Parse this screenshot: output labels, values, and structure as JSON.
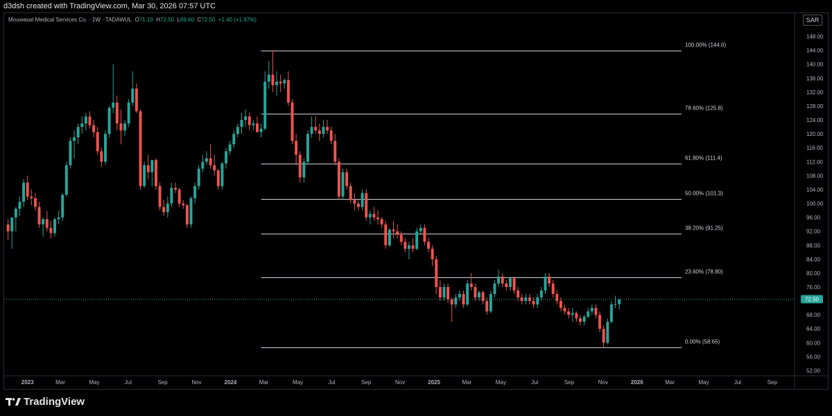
{
  "header": {
    "attribution": "d3dsh created with TradingView.com, Mar 30, 2026 07:57 UTC"
  },
  "legend": {
    "symbol": "Mouwasat Medical Services Co. · 1W · TADAWUL",
    "open_label": "O",
    "open": "71.10",
    "high_label": "H",
    "high": "72.50",
    "low_label": "L",
    "low": "69.60",
    "close_label": "C",
    "close": "72.50",
    "change": "+1.40 (+1.97%)"
  },
  "currency": "SAR",
  "brand": {
    "name": "TradingView",
    "logo_icon": "tradingview-logo-icon"
  },
  "colors": {
    "up": "#26a69a",
    "down": "#ef5350",
    "fib": "#d1d4dc",
    "price_tag": "#26a69a",
    "background": "#000000"
  },
  "chart_data": {
    "type": "candlestick",
    "timeframe": "1W",
    "y_axis": {
      "ticks": [
        "52.00",
        "56.00",
        "60.00",
        "64.00",
        "68.00",
        "72.00",
        "76.00",
        "80.00",
        "84.00",
        "88.00",
        "92.00",
        "96.00",
        "100.00",
        "104.00",
        "108.00",
        "112.00",
        "116.00",
        "120.00",
        "124.00",
        "128.00",
        "132.00",
        "136.00",
        "140.00",
        "144.00",
        "148.00"
      ],
      "range": [
        50.5,
        150.5
      ],
      "last_price_label": "72.50",
      "last_price": 72.5
    },
    "x_axis": {
      "range": [
        "2022-11-20",
        "2026-10-10"
      ],
      "ticks": [
        {
          "label": "2023",
          "date": "2023-01-01",
          "bold": true
        },
        {
          "label": "Mar",
          "date": "2023-03-01"
        },
        {
          "label": "May",
          "date": "2023-05-01"
        },
        {
          "label": "Jul",
          "date": "2023-07-01"
        },
        {
          "label": "Sep",
          "date": "2023-09-01"
        },
        {
          "label": "Nov",
          "date": "2023-11-01"
        },
        {
          "label": "2024",
          "date": "2024-01-01",
          "bold": true
        },
        {
          "label": "Mar",
          "date": "2024-03-01"
        },
        {
          "label": "May",
          "date": "2024-05-01"
        },
        {
          "label": "Jul",
          "date": "2024-07-01"
        },
        {
          "label": "Sep",
          "date": "2024-09-01"
        },
        {
          "label": "Nov",
          "date": "2024-11-01"
        },
        {
          "label": "2025",
          "date": "2025-01-01",
          "bold": true
        },
        {
          "label": "Mar",
          "date": "2025-03-01"
        },
        {
          "label": "May",
          "date": "2025-05-01"
        },
        {
          "label": "Jul",
          "date": "2025-07-01"
        },
        {
          "label": "Sep",
          "date": "2025-09-01"
        },
        {
          "label": "Nov",
          "date": "2025-11-01"
        },
        {
          "label": "2026",
          "date": "2026-01-01",
          "bold": true
        },
        {
          "label": "Mar",
          "date": "2026-03-01"
        },
        {
          "label": "May",
          "date": "2026-05-01"
        },
        {
          "label": "Jul",
          "date": "2026-07-01"
        },
        {
          "label": "Sep",
          "date": "2026-09-01"
        }
      ]
    },
    "fibonacci": {
      "start_date": "2024-02-25",
      "end_date": "2026-03-22",
      "levels": [
        {
          "label": "100.00% (144.0)",
          "value": 144.0
        },
        {
          "label": "78.60% (125.8)",
          "value": 125.8
        },
        {
          "label": "61.80% (111.4)",
          "value": 111.4
        },
        {
          "label": "50.00% (101.3)",
          "value": 101.3
        },
        {
          "label": "38.20% (91.25)",
          "value": 91.25
        },
        {
          "label": "23.60% (78.80)",
          "value": 78.8
        },
        {
          "label": "0.00% (58.65)",
          "value": 58.65
        }
      ]
    },
    "start_date": "2022-11-27",
    "candles": [
      [
        94.0,
        95.5,
        89.5,
        92.0
      ],
      [
        92.0,
        95.5,
        87.0,
        96.0
      ],
      [
        96.0,
        99.0,
        92.0,
        98.5
      ],
      [
        98.5,
        102.0,
        96.5,
        100.5
      ],
      [
        100.5,
        107.0,
        99.0,
        106.0
      ],
      [
        106.0,
        108.0,
        101.0,
        102.0
      ],
      [
        102.0,
        104.0,
        99.5,
        101.5
      ],
      [
        101.5,
        103.0,
        98.0,
        99.0
      ],
      [
        99.0,
        100.5,
        93.0,
        94.0
      ],
      [
        94.0,
        96.0,
        90.5,
        95.5
      ],
      [
        95.5,
        98.0,
        92.0,
        93.0
      ],
      [
        93.0,
        95.0,
        90.0,
        91.5
      ],
      [
        91.5,
        96.0,
        90.5,
        95.5
      ],
      [
        95.5,
        98.0,
        94.0,
        96.0
      ],
      [
        96.0,
        103.0,
        95.0,
        102.5
      ],
      [
        102.5,
        112.0,
        102.0,
        111.0
      ],
      [
        111.0,
        119.0,
        110.0,
        118.0
      ],
      [
        118.0,
        121.0,
        113.0,
        119.0
      ],
      [
        119.0,
        123.0,
        117.0,
        122.0
      ],
      [
        122.0,
        125.0,
        120.0,
        123.0
      ],
      [
        123.0,
        126.0,
        121.0,
        125.0
      ],
      [
        125.0,
        126.5,
        121.5,
        122.5
      ],
      [
        122.5,
        124.0,
        119.0,
        120.5
      ],
      [
        120.5,
        122.0,
        114.0,
        115.0
      ],
      [
        115.0,
        116.0,
        110.5,
        112.0
      ],
      [
        112.0,
        121.0,
        111.0,
        120.0
      ],
      [
        120.0,
        128.0,
        119.0,
        127.5
      ],
      [
        127.5,
        140.0,
        126.0,
        129.0
      ],
      [
        129.0,
        131.0,
        121.0,
        123.0
      ],
      [
        123.0,
        127.0,
        117.0,
        121.0
      ],
      [
        121.0,
        124.0,
        119.5,
        123.0
      ],
      [
        123.0,
        130.0,
        122.0,
        129.0
      ],
      [
        129.0,
        138.0,
        128.0,
        133.0
      ],
      [
        133.0,
        134.5,
        126.0,
        126.5
      ],
      [
        126.5,
        127.0,
        104.0,
        105.0
      ],
      [
        105.0,
        112.0,
        104.5,
        111.0
      ],
      [
        111.0,
        114.0,
        107.0,
        109.0
      ],
      [
        109.0,
        112.0,
        105.0,
        112.5
      ],
      [
        112.5,
        113.0,
        104.0,
        105.0
      ],
      [
        105.0,
        106.0,
        98.0,
        99.0
      ],
      [
        99.0,
        101.0,
        96.5,
        97.5
      ],
      [
        97.5,
        102.0,
        96.0,
        100.0
      ],
      [
        100.0,
        106.0,
        99.0,
        104.5
      ],
      [
        104.5,
        106.0,
        103.0,
        104.0
      ],
      [
        104.0,
        104.5,
        99.0,
        100.0
      ],
      [
        100.0,
        101.0,
        98.5,
        99.5
      ],
      [
        99.5,
        100.0,
        93.0,
        94.0
      ],
      [
        94.0,
        102.0,
        93.0,
        101.5
      ],
      [
        101.5,
        106.0,
        100.0,
        105.0
      ],
      [
        105.0,
        111.0,
        104.0,
        110.0
      ],
      [
        110.0,
        114.0,
        109.0,
        112.0
      ],
      [
        112.0,
        115.0,
        111.0,
        113.0
      ],
      [
        113.0,
        117.0,
        110.0,
        111.0
      ],
      [
        111.0,
        114.0,
        108.0,
        109.5
      ],
      [
        109.5,
        110.0,
        104.0,
        105.0
      ],
      [
        105.0,
        112.0,
        104.0,
        111.5
      ],
      [
        111.5,
        116.0,
        110.0,
        115.0
      ],
      [
        115.0,
        118.0,
        114.0,
        117.0
      ],
      [
        117.0,
        121.0,
        116.0,
        120.0
      ],
      [
        120.0,
        123.0,
        119.0,
        122.0
      ],
      [
        122.0,
        126.0,
        120.0,
        124.0
      ],
      [
        124.0,
        127.0,
        122.0,
        125.0
      ],
      [
        125.0,
        126.0,
        121.0,
        122.5
      ],
      [
        122.5,
        124.0,
        121.0,
        123.0
      ],
      [
        123.0,
        125.0,
        122.0,
        120.5
      ],
      [
        120.5,
        123.0,
        119.0,
        121.5
      ],
      [
        121.5,
        138.0,
        121.0,
        135.0
      ],
      [
        135.0,
        141.0,
        133.0,
        137.0
      ],
      [
        137.0,
        144.0,
        132.0,
        134.0
      ],
      [
        134.0,
        138.0,
        131.0,
        135.0
      ],
      [
        135.0,
        137.0,
        132.0,
        134.5
      ],
      [
        134.5,
        136.0,
        133.0,
        135.5
      ],
      [
        135.5,
        138.0,
        128.0,
        129.0
      ],
      [
        129.0,
        130.0,
        117.0,
        118.0
      ],
      [
        118.0,
        120.0,
        111.0,
        114.0
      ],
      [
        114.0,
        115.0,
        106.0,
        107.5
      ],
      [
        107.5,
        113.0,
        106.0,
        112.0
      ],
      [
        112.0,
        121.0,
        111.0,
        120.0
      ],
      [
        120.0,
        125.0,
        119.0,
        122.0
      ],
      [
        122.0,
        125.0,
        120.0,
        121.0
      ],
      [
        121.0,
        123.0,
        118.0,
        120.0
      ],
      [
        120.0,
        124.0,
        119.0,
        122.0
      ],
      [
        122.0,
        124.0,
        120.0,
        121.0
      ],
      [
        121.0,
        122.0,
        117.0,
        118.0
      ],
      [
        118.0,
        120.0,
        111.0,
        112.0
      ],
      [
        112.0,
        113.0,
        101.0,
        102.0
      ],
      [
        102.0,
        110.0,
        101.0,
        109.0
      ],
      [
        109.0,
        110.0,
        104.0,
        105.0
      ],
      [
        105.0,
        106.0,
        100.0,
        101.0
      ],
      [
        101.0,
        103.0,
        98.0,
        100.0
      ],
      [
        100.0,
        101.0,
        98.0,
        99.0
      ],
      [
        99.0,
        104.0,
        98.0,
        103.0
      ],
      [
        103.0,
        104.0,
        95.0,
        96.0
      ],
      [
        96.0,
        98.0,
        94.0,
        97.0
      ],
      [
        97.0,
        99.0,
        95.0,
        96.0
      ],
      [
        96.0,
        98.0,
        94.0,
        95.5
      ],
      [
        95.5,
        96.0,
        93.0,
        94.0
      ],
      [
        94.0,
        95.0,
        87.0,
        88.0
      ],
      [
        88.0,
        93.0,
        87.5,
        92.5
      ],
      [
        92.5,
        95.0,
        90.0,
        92.0
      ],
      [
        92.0,
        94.0,
        90.0,
        91.0
      ],
      [
        91.0,
        92.0,
        88.0,
        89.0
      ],
      [
        89.0,
        90.0,
        86.0,
        87.0
      ],
      [
        87.0,
        89.0,
        84.0,
        88.0
      ],
      [
        88.0,
        90.0,
        86.0,
        87.0
      ],
      [
        87.0,
        93.0,
        86.5,
        92.0
      ],
      [
        92.0,
        94.0,
        91.0,
        93.0
      ],
      [
        93.0,
        94.0,
        88.0,
        89.0
      ],
      [
        89.0,
        90.0,
        86.0,
        87.0
      ],
      [
        87.0,
        88.0,
        82.0,
        84.0
      ],
      [
        84.0,
        85.0,
        74.0,
        76.0
      ],
      [
        76.0,
        78.0,
        72.0,
        73.0
      ],
      [
        73.0,
        77.0,
        72.0,
        76.0
      ],
      [
        76.0,
        77.0,
        71.5,
        72.5
      ],
      [
        72.5,
        73.0,
        66.0,
        71.0
      ],
      [
        71.0,
        74.0,
        70.0,
        73.0
      ],
      [
        73.0,
        75.0,
        72.0,
        74.0
      ],
      [
        74.0,
        75.0,
        70.0,
        71.0
      ],
      [
        71.0,
        78.0,
        70.5,
        77.0
      ],
      [
        77.0,
        80.0,
        75.0,
        76.0
      ],
      [
        76.0,
        77.0,
        72.0,
        73.0
      ],
      [
        73.0,
        75.0,
        72.0,
        74.5
      ],
      [
        74.5,
        75.0,
        71.0,
        72.0
      ],
      [
        72.0,
        73.0,
        68.0,
        69.0
      ],
      [
        69.0,
        75.0,
        68.5,
        74.0
      ],
      [
        74.0,
        78.0,
        73.0,
        77.0
      ],
      [
        77.0,
        81.0,
        76.0,
        79.0
      ],
      [
        79.0,
        80.0,
        76.0,
        77.0
      ],
      [
        77.0,
        78.0,
        75.0,
        76.0
      ],
      [
        76.0,
        79.0,
        75.0,
        78.5
      ],
      [
        78.5,
        79.0,
        74.0,
        75.0
      ],
      [
        75.0,
        76.0,
        72.0,
        73.0
      ],
      [
        73.0,
        74.0,
        71.0,
        72.0
      ],
      [
        72.0,
        74.0,
        71.0,
        73.0
      ],
      [
        73.0,
        74.0,
        71.0,
        72.0
      ],
      [
        72.0,
        73.0,
        70.0,
        71.0
      ],
      [
        71.0,
        74.0,
        70.0,
        73.0
      ],
      [
        73.0,
        76.0,
        72.0,
        75.0
      ],
      [
        75.0,
        80.0,
        74.0,
        79.0
      ],
      [
        79.0,
        80.0,
        76.0,
        77.0
      ],
      [
        77.0,
        78.0,
        73.0,
        74.0
      ],
      [
        74.0,
        75.0,
        71.0,
        72.0
      ],
      [
        72.0,
        73.0,
        69.0,
        70.0
      ],
      [
        70.0,
        71.0,
        68.0,
        69.0
      ],
      [
        69.0,
        70.0,
        67.0,
        68.0
      ],
      [
        68.0,
        70.0,
        66.0,
        68.5
      ],
      [
        68.5,
        69.0,
        66.0,
        67.0
      ],
      [
        67.0,
        68.0,
        65.0,
        66.0
      ],
      [
        66.0,
        68.0,
        65.0,
        67.5
      ],
      [
        67.5,
        70.0,
        67.0,
        69.0
      ],
      [
        69.0,
        71.0,
        68.0,
        70.0
      ],
      [
        70.0,
        71.0,
        67.0,
        68.0
      ],
      [
        68.0,
        69.0,
        63.0,
        64.0
      ],
      [
        64.0,
        65.0,
        58.65,
        60.0
      ],
      [
        60.0,
        67.0,
        59.5,
        66.0
      ],
      [
        66.0,
        72.0,
        65.5,
        71.0
      ],
      [
        71.0,
        73.5,
        70.0,
        71.1
      ],
      [
        71.1,
        72.5,
        69.6,
        72.5
      ]
    ]
  }
}
